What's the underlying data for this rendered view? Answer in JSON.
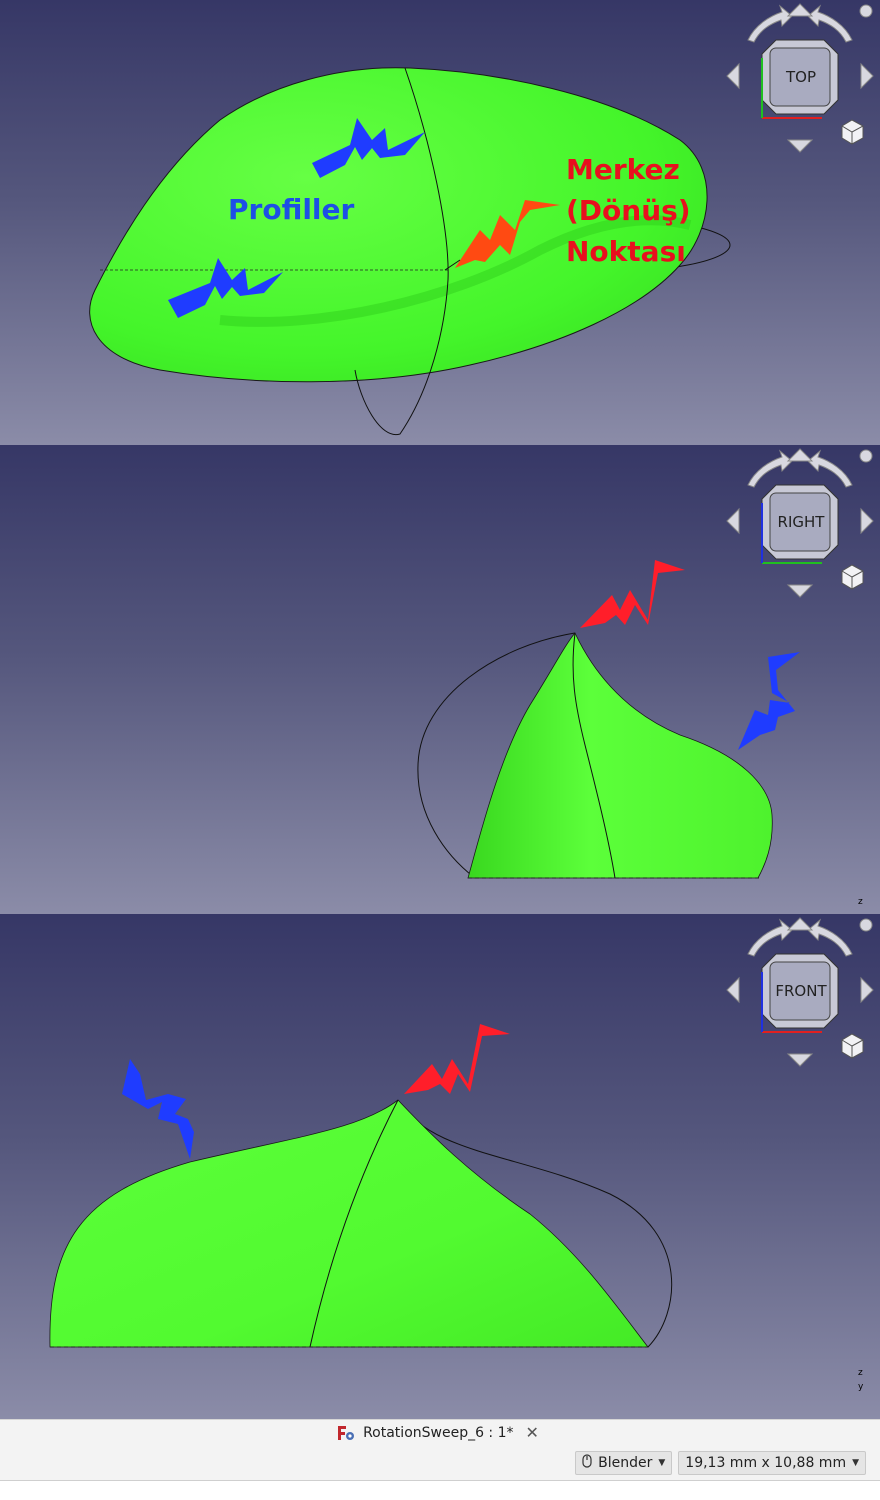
{
  "views": {
    "top": {
      "cube_face": "TOP",
      "annotations": {
        "profiles": "Profiller",
        "center_line1": "Merkez",
        "center_line2": "(Dönüş)",
        "center_line3": "Noktası"
      }
    },
    "right": {
      "cube_face": "RIGHT",
      "axis_label": "z"
    },
    "front": {
      "cube_face": "FRONT",
      "axis_label_z": "z",
      "axis_label_y": "y"
    }
  },
  "colors": {
    "surface": "#55ff33",
    "profile_arrow": "#1f3cff",
    "center_arrow_top": "#ff4a12",
    "center_arrow": "#ff1e2a",
    "annotation_blue": "#1d4fe6",
    "annotation_red": "#e8101e"
  },
  "tab": {
    "icon": "freecad-document-icon",
    "title": "RotationSweep_6 : 1*",
    "close": "✕"
  },
  "statusbar": {
    "navigation_style": "Blender",
    "dimensions": "19,13 mm x 10,88 mm"
  }
}
